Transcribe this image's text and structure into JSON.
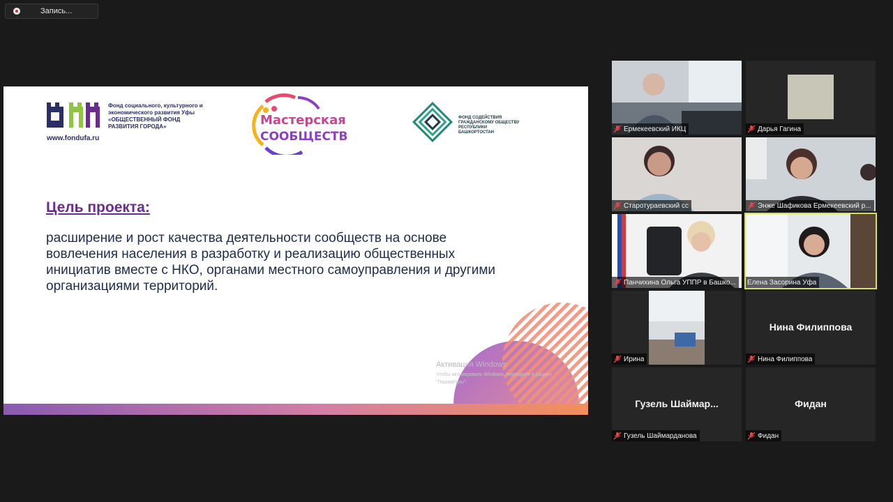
{
  "recording": {
    "label": "Запись..."
  },
  "slide": {
    "logo1": {
      "text_lines": [
        "Фонд социального, культурного и",
        "экономического развития Уфы",
        "«ОБЩЕСТВЕННЫЙ ФОНД",
        "РАЗВИТИЯ ГОРОДА»"
      ],
      "url": "www.fondufa.ru"
    },
    "logo2": {
      "line1": "Мастерская",
      "line2": "СООБЩЕСТВ"
    },
    "logo3": {
      "text_lines": [
        "ФОНД СОДЕЙСТВИЯ",
        "ГРАЖДАНСКОМУ ОБЩЕСТВУ",
        "РЕСПУБЛИКИ БАШКОРТОСТАН"
      ]
    },
    "goal_title": "Цель проекта:",
    "goal_body": "расширение и рост качества деятельности сообществ на основе\nвовлечения населения  в разработку и реализацию общественных\nинициатив вместе с НКО, органами местного самоуправления и другими\nорганизациями территорий.",
    "windows_activation": {
      "title": "Активация Windows",
      "line1": "Чтобы активировать Windows, перейдите в раздел",
      "line2": "\"Параметры\"."
    }
  },
  "colors": {
    "active_speaker_border": "#d6e15a",
    "muted_mic": "#e0454b",
    "slide_accent": "#6b2c91"
  },
  "participants": [
    {
      "name": "Ермекеевский ИКЦ",
      "video": true,
      "muted": true
    },
    {
      "name": "Дарья Гагина",
      "video": true,
      "muted": true
    },
    {
      "name": "Старотураевский сс",
      "video": true,
      "muted": true
    },
    {
      "name": "Энже Шафикова Ермекеевский р...",
      "video": true,
      "muted": true
    },
    {
      "name": "Панчихина Ольга УППР в Башко...",
      "video": true,
      "muted": true
    },
    {
      "name": "Елена Засорина Уфа",
      "video": true,
      "muted": false,
      "active": true
    },
    {
      "name": "Ирина",
      "video": true,
      "muted": true
    },
    {
      "name": "Нина Филиппова",
      "display": "Нина Филиппова",
      "video": false,
      "muted": true
    },
    {
      "name": "Гузель Шаймарданова",
      "display": "Гузель  Шаймар...",
      "video": false,
      "muted": true
    },
    {
      "name": "Фидан",
      "display": "Фидан",
      "video": false,
      "muted": true
    }
  ]
}
